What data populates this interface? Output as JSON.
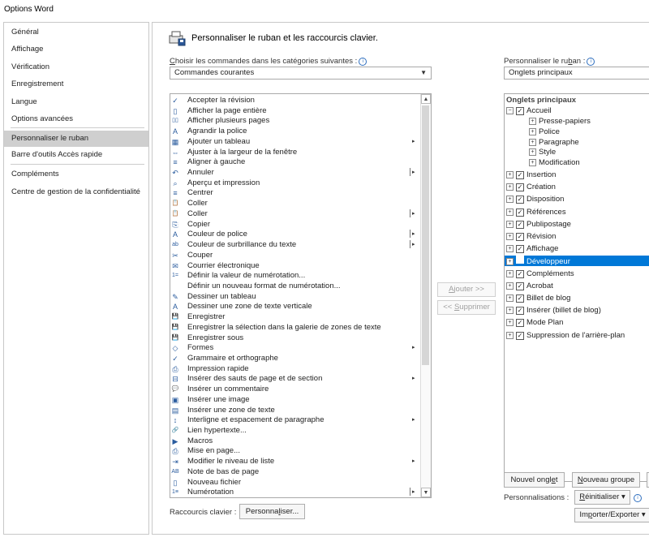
{
  "window": {
    "title": "Options Word"
  },
  "sidebar": {
    "items": [
      {
        "label": "Général",
        "selected": false
      },
      {
        "label": "Affichage",
        "selected": false
      },
      {
        "label": "Vérification",
        "selected": false
      },
      {
        "label": "Enregistrement",
        "selected": false
      },
      {
        "label": "Langue",
        "selected": false
      },
      {
        "label": "Options avancées",
        "selected": false
      },
      {
        "label": "Personnaliser le ruban",
        "selected": true
      },
      {
        "label": "Barre d'outils Accès rapide",
        "selected": false
      },
      {
        "label": "Compléments",
        "selected": false
      },
      {
        "label": "Centre de gestion de la confidentialité",
        "selected": false
      }
    ]
  },
  "header": {
    "title": "Personnaliser le ruban et les raccourcis clavier.",
    "icon": "customize-ribbon-icon"
  },
  "left": {
    "choose_label_prefix": "C",
    "choose_label_rest": "hoisir les commandes dans les catégories suivantes :",
    "choose_value": "Commandes courantes",
    "commands": [
      {
        "label": "Accepter la révision",
        "icon": "accept-revision-icon",
        "glyph": "✓",
        "submenu": ""
      },
      {
        "label": "Afficher la page entière",
        "icon": "whole-page-icon",
        "glyph": "▯",
        "submenu": ""
      },
      {
        "label": "Afficher plusieurs pages",
        "icon": "multiple-pages-icon",
        "glyph": "▯▯",
        "submenu": ""
      },
      {
        "label": "Agrandir la police",
        "icon": "grow-font-icon",
        "glyph": "A",
        "submenu": ""
      },
      {
        "label": "Ajouter un tableau",
        "icon": "table-icon",
        "glyph": "▦",
        "submenu": "▸"
      },
      {
        "label": "Ajuster à la largeur de la fenêtre",
        "icon": "page-width-icon",
        "glyph": "⇔",
        "submenu": ""
      },
      {
        "label": "Aligner à gauche",
        "icon": "align-left-icon",
        "glyph": "≡",
        "submenu": ""
      },
      {
        "label": "Annuler",
        "icon": "undo-icon",
        "glyph": "↶",
        "submenu": "split"
      },
      {
        "label": "Aperçu et impression",
        "icon": "print-preview-icon",
        "glyph": "⌕",
        "submenu": ""
      },
      {
        "label": "Centrer",
        "icon": "center-icon",
        "glyph": "≡",
        "submenu": ""
      },
      {
        "label": "Coller",
        "icon": "paste-icon",
        "glyph": "📋",
        "submenu": ""
      },
      {
        "label": "Coller",
        "icon": "paste-menu-icon",
        "glyph": "📋",
        "submenu": "split"
      },
      {
        "label": "Copier",
        "icon": "copy-icon",
        "glyph": "⎘",
        "submenu": ""
      },
      {
        "label": "Couleur de police",
        "icon": "font-color-icon",
        "glyph": "A",
        "submenu": "split"
      },
      {
        "label": "Couleur de surbrillance du texte",
        "icon": "highlight-icon",
        "glyph": "ab",
        "submenu": "split"
      },
      {
        "label": "Couper",
        "icon": "cut-icon",
        "glyph": "✂",
        "submenu": ""
      },
      {
        "label": "Courrier électronique",
        "icon": "email-icon",
        "glyph": "✉",
        "submenu": ""
      },
      {
        "label": "Définir la valeur de numérotation...",
        "icon": "numbering-value-icon",
        "glyph": "1=",
        "submenu": ""
      },
      {
        "label": "Définir un nouveau format de numérotation...",
        "icon": "",
        "glyph": "",
        "submenu": ""
      },
      {
        "label": "Dessiner un tableau",
        "icon": "draw-table-icon",
        "glyph": "✎",
        "submenu": ""
      },
      {
        "label": "Dessiner une zone de texte verticale",
        "icon": "vertical-textbox-icon",
        "glyph": "A",
        "submenu": ""
      },
      {
        "label": "Enregistrer",
        "icon": "save-icon",
        "glyph": "💾",
        "submenu": ""
      },
      {
        "label": "Enregistrer la sélection dans la galerie de zones de texte",
        "icon": "save-selection-icon",
        "glyph": "💾",
        "submenu": ""
      },
      {
        "label": "Enregistrer sous",
        "icon": "save-as-icon",
        "glyph": "💾",
        "submenu": ""
      },
      {
        "label": "Formes",
        "icon": "shapes-icon",
        "glyph": "◇",
        "submenu": "▸"
      },
      {
        "label": "Grammaire et orthographe",
        "icon": "spelling-icon",
        "glyph": "✓",
        "submenu": ""
      },
      {
        "label": "Impression rapide",
        "icon": "quick-print-icon",
        "glyph": "⎙",
        "submenu": ""
      },
      {
        "label": "Insérer des sauts de page et de section",
        "icon": "page-break-icon",
        "glyph": "⊟",
        "submenu": "▸"
      },
      {
        "label": "Insérer un commentaire",
        "icon": "comment-icon",
        "glyph": "💬",
        "submenu": ""
      },
      {
        "label": "Insérer une image",
        "icon": "picture-icon",
        "glyph": "▣",
        "submenu": ""
      },
      {
        "label": "Insérer une zone de texte",
        "icon": "textbox-icon",
        "glyph": "▤",
        "submenu": ""
      },
      {
        "label": "Interligne et espacement de paragraphe",
        "icon": "line-spacing-icon",
        "glyph": "↕",
        "submenu": "▸"
      },
      {
        "label": "Lien hypertexte...",
        "icon": "hyperlink-icon",
        "glyph": "🔗",
        "submenu": ""
      },
      {
        "label": "Macros",
        "icon": "macros-icon",
        "glyph": "▶",
        "submenu": ""
      },
      {
        "label": "Mise en page...",
        "icon": "page-setup-icon",
        "glyph": "⎙",
        "submenu": ""
      },
      {
        "label": "Modifier le niveau de liste",
        "icon": "list-level-icon",
        "glyph": "⇥",
        "submenu": "▸"
      },
      {
        "label": "Note de bas de page",
        "icon": "footnote-icon",
        "glyph": "AB",
        "submenu": ""
      },
      {
        "label": "Nouveau fichier",
        "icon": "new-file-icon",
        "glyph": "▯",
        "submenu": ""
      },
      {
        "label": "Numérotation",
        "icon": "numbering-icon",
        "glyph": "1≡",
        "submenu": "split"
      }
    ],
    "shortcuts_label": "Raccourcis clavier :",
    "shortcuts_button_prefix": "Personna",
    "shortcuts_button_key": "l",
    "shortcuts_button_rest": "iser..."
  },
  "middle": {
    "add_prefix": "A",
    "add_rest": "jouter >>",
    "remove_prefix": "<< ",
    "remove_key": "S",
    "remove_rest": "upprimer"
  },
  "right": {
    "customize_label_prefix": "Personnaliser le ru",
    "customize_label_key": "b",
    "customize_label_rest": "an :",
    "customize_value": "Onglets principaux",
    "tree_header": "Onglets principaux",
    "tabs": [
      {
        "label": "Accueil",
        "checked": true,
        "expanded": true,
        "selected": false
      },
      {
        "label": "Insertion",
        "checked": true,
        "expanded": false,
        "selected": false
      },
      {
        "label": "Création",
        "checked": true,
        "expanded": false,
        "selected": false
      },
      {
        "label": "Disposition",
        "checked": true,
        "expanded": false,
        "selected": false
      },
      {
        "label": "Références",
        "checked": true,
        "expanded": false,
        "selected": false
      },
      {
        "label": "Publipostage",
        "checked": true,
        "expanded": false,
        "selected": false
      },
      {
        "label": "Révision",
        "checked": true,
        "expanded": false,
        "selected": false
      },
      {
        "label": "Affichage",
        "checked": true,
        "expanded": false,
        "selected": false
      },
      {
        "label": "Développeur",
        "checked": false,
        "expanded": false,
        "selected": true
      },
      {
        "label": "Compléments",
        "checked": true,
        "expanded": false,
        "selected": false
      },
      {
        "label": "Acrobat",
        "checked": true,
        "expanded": false,
        "selected": false
      },
      {
        "label": "Billet de blog",
        "checked": true,
        "expanded": false,
        "selected": false
      },
      {
        "label": "Insérer (billet de blog)",
        "checked": true,
        "expanded": false,
        "selected": false
      },
      {
        "label": "Mode Plan",
        "checked": true,
        "expanded": false,
        "selected": false
      },
      {
        "label": "Suppression de l'arrière-plan",
        "checked": true,
        "expanded": false,
        "selected": false
      }
    ],
    "accueil_groups": [
      "Presse-papiers",
      "Police",
      "Paragraphe",
      "Style",
      "Modification"
    ],
    "new_tab_prefix": "Nouvel ongl",
    "new_tab_key": "e",
    "new_tab_rest": "t",
    "new_group_prefix": "",
    "new_group_key": "N",
    "new_group_rest": "ouveau groupe",
    "personalizations_label": "Personnalisations :",
    "reset_prefix": "",
    "reset_key": "R",
    "reset_rest": "éinitialiser ▾",
    "import_export_prefix": "Im",
    "import_export_key": "p",
    "import_export_rest": "orter/Exporter ▾"
  }
}
